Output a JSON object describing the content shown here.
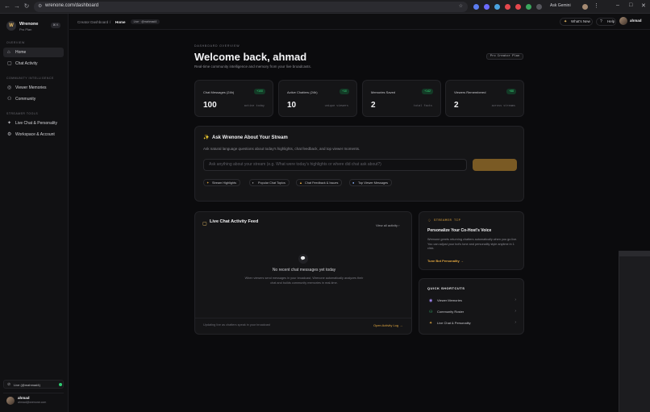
{
  "browser": {
    "url": "wrenone.com/dashboard",
    "ask_gemini": "Ask Gemini"
  },
  "sidebar": {
    "workspace_name": "Wrenone",
    "workspace_sub": "Pro Plan",
    "workspace_badge": "⌘ K",
    "logo_letter": "W",
    "sections": [
      {
        "label": "OVERVIEW",
        "items": [
          {
            "label": "Home",
            "icon": "home-icon",
            "active": true
          },
          {
            "label": "Chat Activity",
            "icon": "chat-icon"
          }
        ]
      },
      {
        "label": "COMMUNITY INTELLIGENCE",
        "items": [
          {
            "label": "Viewer Memories",
            "icon": "memory-icon"
          },
          {
            "label": "Community",
            "icon": "users-icon"
          }
        ]
      },
      {
        "label": "STREAMER TOOLS",
        "items": [
          {
            "label": "Live Chat & Personality",
            "icon": "sparkle-icon"
          },
          {
            "label": "Workspace & Account",
            "icon": "gear-icon"
          }
        ]
      }
    ],
    "live_label": "Live (@mahmad4)",
    "profile_name": "ahmad",
    "profile_email": "ahmad@wrenone.com"
  },
  "topbar": {
    "crumb_1": "Creator Dashboard",
    "sep": "/",
    "crumb_2": "Home",
    "live_pill": "Live · @mahmad4",
    "whats_new": "What's New",
    "help": "Help",
    "user": "ahmad"
  },
  "main": {
    "eyebrow": "DASHBOARD OVERVIEW",
    "title": "Welcome back, ahmad",
    "subtitle": "Real-time community intelligence and memory from your live broadcasts.",
    "plan": "Pro Creator Plan",
    "stats": [
      {
        "title": "Chat Messages (24h)",
        "delta": "+100",
        "value": "100",
        "caption": "active today"
      },
      {
        "title": "Active Chatters (24h)",
        "delta": "+10",
        "value": "10",
        "caption": "unique viewers"
      },
      {
        "title": "Memories Saved",
        "delta": "+142",
        "value": "2",
        "caption": "total facts"
      },
      {
        "title": "Viewers Remembered",
        "delta": "+88",
        "value": "2",
        "caption": "across streams"
      }
    ],
    "ask": {
      "title": "Ask Wrenone About Your Stream",
      "desc": "Ask natural language questions about today's highlights, chat feedback, and top viewer moments.",
      "placeholder": "Ask anything about your stream (e.g. What were today's highlights or where did chat ask about?)",
      "chips": [
        "Stream Highlights",
        "Popular Chat Topics",
        "Chat Feedback & Issues",
        "Top Viewer Messages"
      ]
    },
    "feed": {
      "title": "Live Chat Activity Feed",
      "view_all": "View all activity",
      "empty_title": "No recent chat messages yet today",
      "empty_desc": "When viewers send messages in your broadcast, Wrenone automatically analyzes their chat and builds community memories in real-time.",
      "footer_left": "Updating live as chatters speak in your broadcast",
      "footer_right": "Open Activity Log →"
    },
    "tip": {
      "label": "STREAMER TIP",
      "title": "Personalize Your Co-Host's Voice",
      "body": "Wrenone greets returning chatters automatically when you go live. You can adjust your bot's tone and personality style anytime in 1 click.",
      "link": "Tune Bot Personality"
    },
    "shortcuts": {
      "label": "QUICK SHORTCUTS",
      "items": [
        {
          "label": "Viewer Memories",
          "icon": "memory-icon",
          "color": "#a78bfa"
        },
        {
          "label": "Community Roster",
          "icon": "users-icon",
          "color": "#37d67a"
        },
        {
          "label": "Live Chat & Personality",
          "icon": "sparkle-icon",
          "color": "#e0a640"
        }
      ]
    }
  }
}
